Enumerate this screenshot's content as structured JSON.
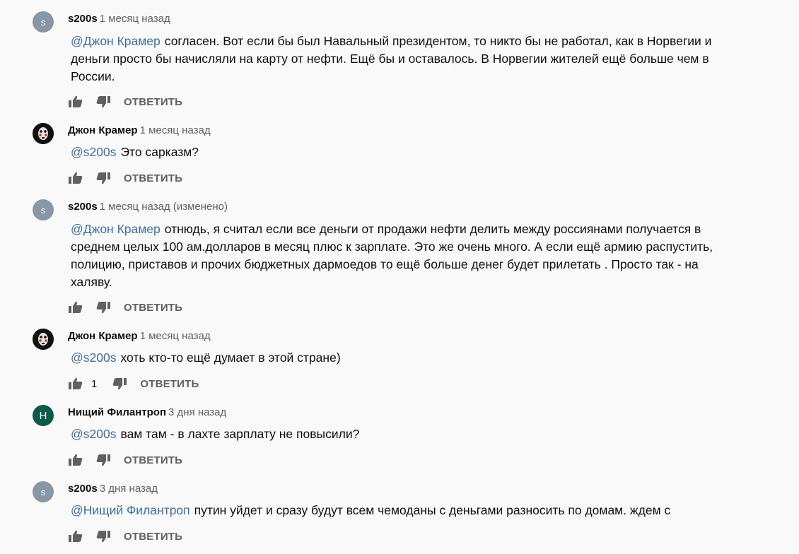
{
  "reply_label": "ОТВЕТИТЬ",
  "comments": [
    {
      "avatar_letter": "s",
      "author": "s200s",
      "time": "1 месяц назад",
      "mention": "@Джон Крамер",
      "text": "согласен. Вот если бы был Навальный президентом, то никто бы не работал, как в Норвегии и деньги просто бы начисляли на карту от нефти. Ещё бы и оставалось. В Норвегии жителей ещё больше чем в России.",
      "likes": ""
    },
    {
      "avatar_letter": "",
      "author": "Джон Крамер",
      "time": "1 месяц назад",
      "mention": "@s200s",
      "text": "Это сарказм?",
      "likes": ""
    },
    {
      "avatar_letter": "s",
      "author": "s200s",
      "time": "1 месяц назад (изменено)",
      "mention": "@Джон Крамер",
      "text": "отнюдь, я считал если все деньги от продажи нефти делить между россиянами получается в среднем целых 100 ам.долларов в месяц плюс к зарплате. Это же очень много. А если ещё армию распустить, полицию, приставов и прочих бюджетных дармоедов то ещё больше денег будет прилетать . Просто так - на халяву.",
      "likes": ""
    },
    {
      "avatar_letter": "",
      "author": "Джон Крамер",
      "time": "1 месяц назад",
      "mention": "@s200s",
      "text": "хоть кто-то ещё думает в этой стране)",
      "likes": "1"
    },
    {
      "avatar_letter": "Н",
      "author": "Нищий Филантроп",
      "time": "3 дня назад",
      "mention": "@s200s",
      "text": "вам там - в лахте зарплату не повысили?",
      "likes": ""
    },
    {
      "avatar_letter": "s",
      "author": "s200s",
      "time": "3 дня назад",
      "mention": "@Нищий Филантроп",
      "text": "путин уйдет и сразу будут всем чемоданы с деньгами разносить по домам. ждем с",
      "likes": ""
    }
  ],
  "colors": {
    "mention": "#3e6fa4",
    "meta": "#606060",
    "avatar_gray": "#8897a6",
    "avatar_green": "#0f5948"
  }
}
